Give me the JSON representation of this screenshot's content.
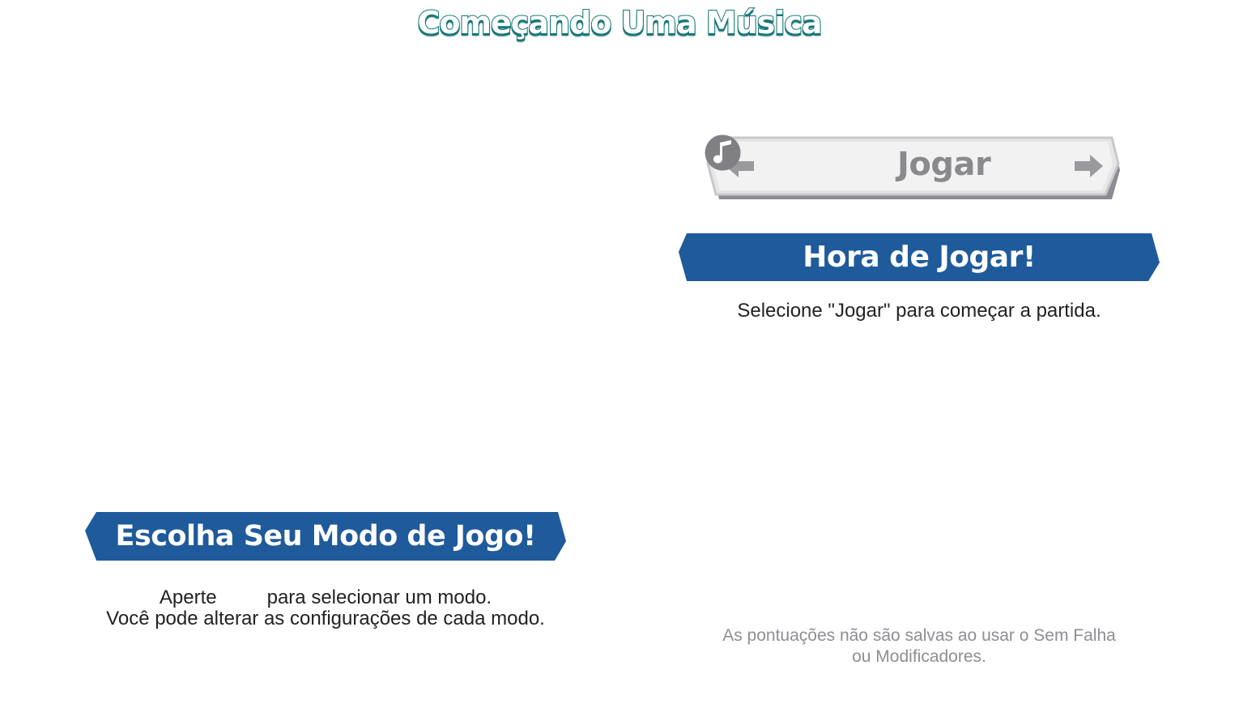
{
  "title": "Começando Uma Música",
  "play_button": {
    "label": "Jogar",
    "icon": "music-note-icon",
    "left_arrow": "arrow-left-icon",
    "right_arrow": "arrow-right-icon"
  },
  "play_section": {
    "heading": "Hora de Jogar!",
    "description": "Selecione \"Jogar\" para começar a partida."
  },
  "mode_section": {
    "heading": "Escolha Seu Modo de Jogo!",
    "line1_before": "Aperte",
    "line1_after": "para selecionar um modo.",
    "line2": "Você pode alterar as configurações de cada modo."
  },
  "footnote": {
    "line1": "As pontuações não são salvas ao usar o Sem Falha",
    "line2": "ou Modificadores."
  },
  "colors": {
    "banner": "#1f5a9b",
    "title_outline": "#16787a",
    "button_face": "#eeeeee",
    "button_shadow": "#8c8c92"
  }
}
